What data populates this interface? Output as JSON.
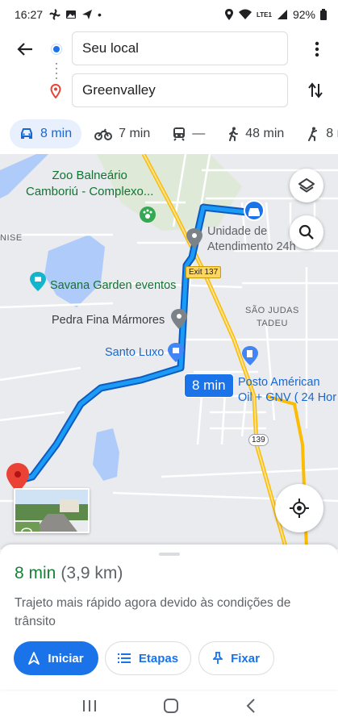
{
  "status_bar": {
    "time": "16:27",
    "battery": "92%",
    "network": "LTE1"
  },
  "directions": {
    "origin": "Seu local",
    "destination": "Greenvalley"
  },
  "modes": [
    {
      "name": "car",
      "label": "8 min",
      "active": true
    },
    {
      "name": "motorcycle",
      "label": "7 min",
      "active": false
    },
    {
      "name": "transit",
      "label": "—",
      "active": false
    },
    {
      "name": "walk",
      "label": "48 min",
      "active": false
    },
    {
      "name": "ride",
      "label": "8 m",
      "active": false
    }
  ],
  "map": {
    "labels": {
      "zoo": "Zoo Balneário\nCamboriú - Complexo...",
      "unidade": "Unidade de\nAtendimento 24h",
      "nise": "NISE",
      "savana": "Savana Garden eventos",
      "pedra": "Pedra Fina Mármores",
      "sao_judas": "SÃO JUDAS\nTADEU",
      "santo_luxo": "Santo Luxo",
      "posto": "Posto Américan\nOil + GNV ( 24 Hor",
      "exit_137": "Exit 137",
      "route_139": "139"
    },
    "route_time": "8 min"
  },
  "sheet": {
    "eta_time": "8 min",
    "eta_distance": "(3,9 km)",
    "description": "Trajeto mais rápido agora devido às condições de trânsito",
    "start_label": "Iniciar",
    "steps_label": "Etapas",
    "pin_label": "Fixar"
  },
  "colors": {
    "accent": "#1a73e8",
    "route": "#1a73e8",
    "eta_green": "#188038",
    "destination_red": "#ea4335"
  }
}
